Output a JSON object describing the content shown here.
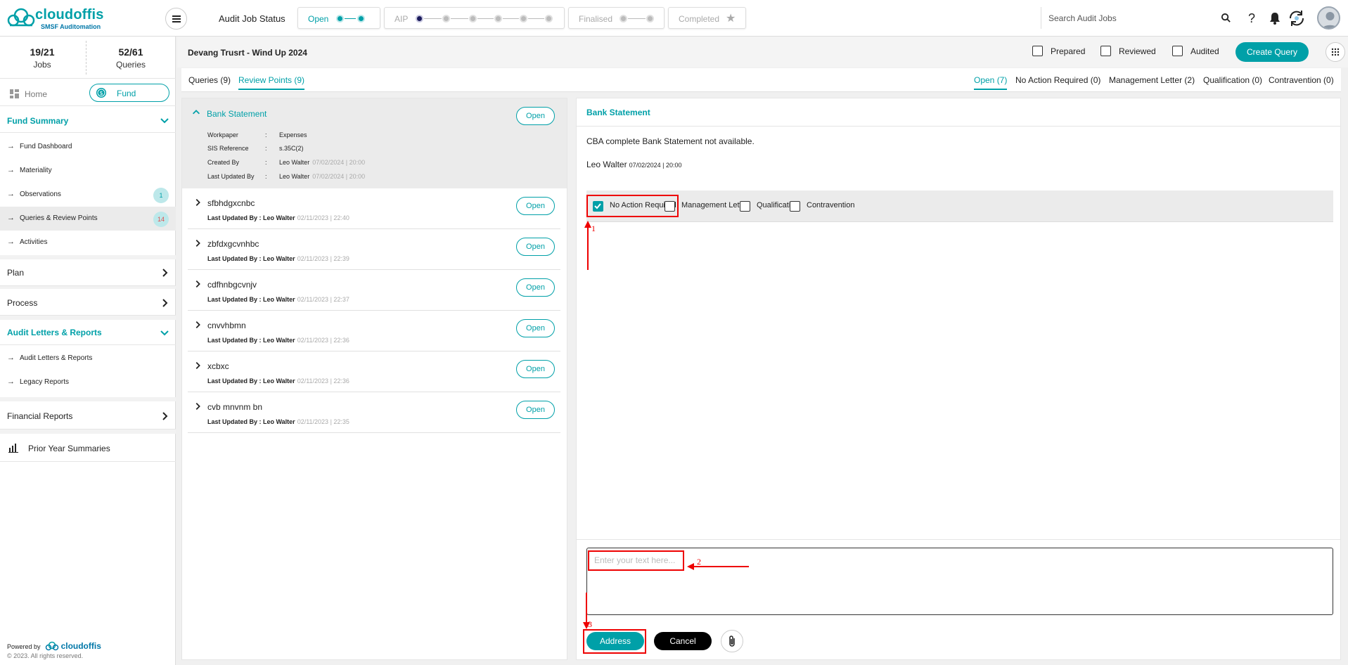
{
  "brand": {
    "name": "cloudoffis",
    "tagline": "SMSF Auditomation"
  },
  "topbar": {
    "status_label": "Audit Job Status",
    "stages": [
      "Open",
      "AIP",
      "Finalised",
      "Completed"
    ],
    "search_placeholder": "Search Audit Jobs"
  },
  "sidebar": {
    "stats": [
      {
        "value": "19/21",
        "label": "Jobs"
      },
      {
        "value": "52/61",
        "label": "Queries"
      }
    ],
    "home": "Home",
    "fund": "Fund",
    "fund_summary": {
      "title": "Fund Summary",
      "items": [
        {
          "label": "Fund Dashboard"
        },
        {
          "label": "Materiality"
        },
        {
          "label": "Observations",
          "count": "1"
        },
        {
          "label": "Queries & Review Points",
          "count": "14"
        },
        {
          "label": "Activities"
        }
      ]
    },
    "plan": "Plan",
    "process": "Process",
    "audit_letters": {
      "title": "Audit Letters & Reports",
      "items": [
        "Audit Letters & Reports",
        "Legacy Reports"
      ]
    },
    "financial_reports": "Financial Reports",
    "prior_year": "Prior Year Summaries",
    "powered_by": "Powered by",
    "copyright": "© 2023. All rights reserved."
  },
  "main": {
    "job_title": "Devang Trusrt - Wind Up 2024",
    "checks": [
      "Prepared",
      "Reviewed",
      "Audited"
    ],
    "create_query": "Create Query",
    "tabs_left": [
      "Queries (9)",
      "Review Points (9)"
    ],
    "tabs_right": [
      "Open (7)",
      "No Action Required (0)",
      "Management Letter (2)",
      "Qualification (0)",
      "Contravention (0)"
    ]
  },
  "list": {
    "expanded": {
      "title": "Bank Statement",
      "status": "Open",
      "meta": [
        {
          "key": "Workpaper",
          "value": "Expenses",
          "date": ""
        },
        {
          "key": "SIS Reference",
          "value": "s.35C(2)",
          "date": ""
        },
        {
          "key": "Created By",
          "value": "Leo Walter",
          "date": "07/02/2024 | 20:00"
        },
        {
          "key": "Last Updated By",
          "value": "Leo Walter",
          "date": "07/02/2024 | 20:00"
        }
      ]
    },
    "rows": [
      {
        "title": "sfbhdgxcnbc",
        "meta": "Last Updated By : Leo Walter",
        "date": "02/11/2023 | 22:40",
        "status": "Open"
      },
      {
        "title": "zbfdxgcvnhbc",
        "meta": "Last Updated By : Leo Walter",
        "date": "02/11/2023 | 22:39",
        "status": "Open"
      },
      {
        "title": "cdfhnbgcvnjv",
        "meta": "Last Updated By : Leo Walter",
        "date": "02/11/2023 | 22:37",
        "status": "Open"
      },
      {
        "title": "cnvvhbmn",
        "meta": "Last Updated By : Leo Walter",
        "date": "02/11/2023 | 22:36",
        "status": "Open"
      },
      {
        "title": "xcbxc",
        "meta": "Last Updated By : Leo Walter",
        "date": "02/11/2023 | 22:36",
        "status": "Open"
      },
      {
        "title": "cvb mnvnm bn",
        "meta": "Last Updated By : Leo Walter",
        "date": "02/11/2023 | 22:35",
        "status": "Open"
      }
    ]
  },
  "detail": {
    "title": "Bank Statement",
    "text": "CBA complete Bank Statement not available.",
    "author": "Leo Walter",
    "date": "07/02/2024 | 20:00",
    "options": [
      "No Action Required",
      "Management Letter",
      "Qualification",
      "Contravention"
    ],
    "selected_option": "No Action Required",
    "comment_placeholder": "Enter your text here...",
    "address": "Address",
    "cancel": "Cancel"
  },
  "annotations": [
    "1",
    "2",
    "3"
  ],
  "colors": {
    "accent": "#00a0a8",
    "annotation": "#e00000"
  }
}
